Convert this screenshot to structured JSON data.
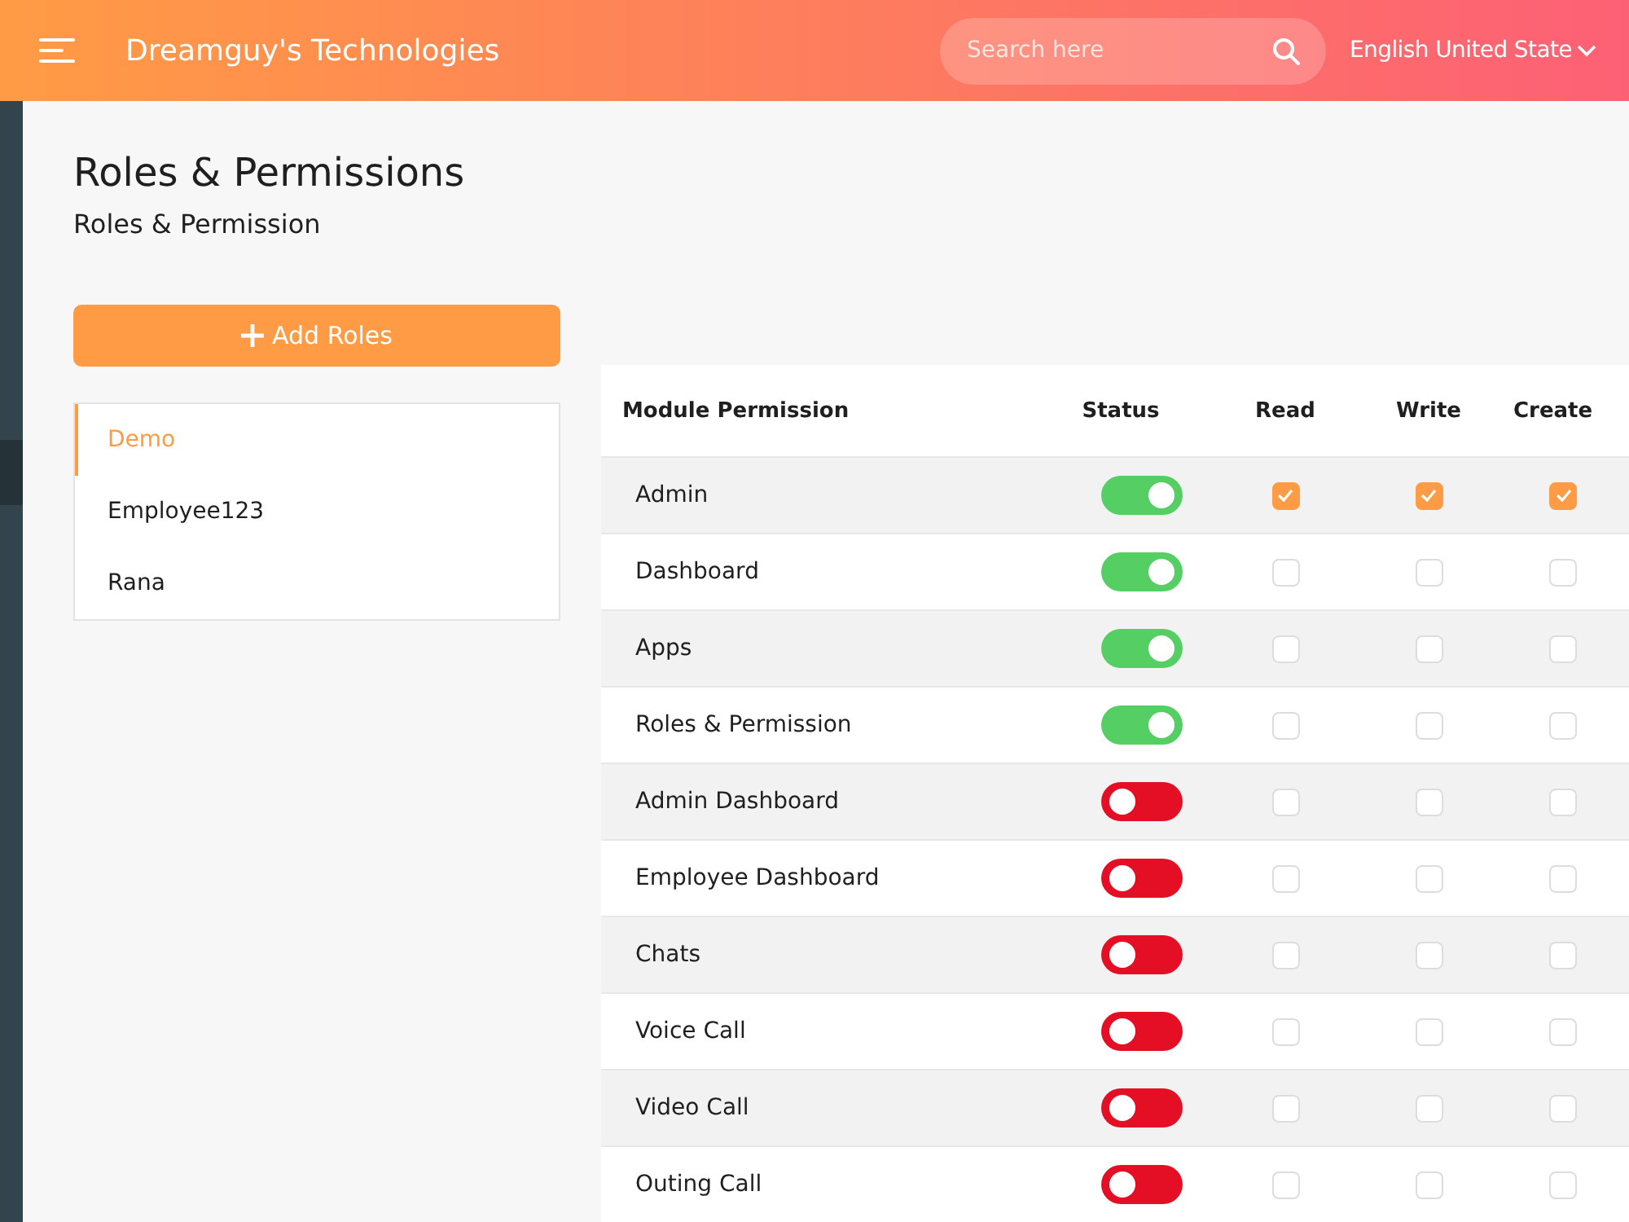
{
  "header": {
    "brand": "Dreamguy's Technologies",
    "search": {
      "placeholder": "Search here"
    },
    "language": "English United State"
  },
  "page": {
    "title": "Roles & Permissions",
    "subtitle": "Roles & Permission"
  },
  "add_button": "Add Roles",
  "roles": [
    {
      "name": "Demo",
      "selected": true
    },
    {
      "name": "Employee123",
      "selected": false
    },
    {
      "name": "Rana",
      "selected": false
    }
  ],
  "table": {
    "columns": [
      "Module Permission",
      "Status",
      "Read",
      "Write",
      "Create"
    ],
    "rows": [
      {
        "module": "Admin",
        "on": true,
        "read": true,
        "write": true,
        "create": true
      },
      {
        "module": "Dashboard",
        "on": true,
        "read": false,
        "write": false,
        "create": false
      },
      {
        "module": "Apps",
        "on": true,
        "read": false,
        "write": false,
        "create": false
      },
      {
        "module": "Roles & Permission",
        "on": true,
        "read": false,
        "write": false,
        "create": false
      },
      {
        "module": "Admin Dashboard",
        "on": false,
        "read": false,
        "write": false,
        "create": false
      },
      {
        "module": "Employee Dashboard",
        "on": false,
        "read": false,
        "write": false,
        "create": false
      },
      {
        "module": "Chats",
        "on": false,
        "read": false,
        "write": false,
        "create": false
      },
      {
        "module": "Voice Call",
        "on": false,
        "read": false,
        "write": false,
        "create": false
      },
      {
        "module": "Video Call",
        "on": false,
        "read": false,
        "write": false,
        "create": false
      },
      {
        "module": "Outing Call",
        "on": false,
        "read": false,
        "write": false,
        "create": false
      }
    ]
  }
}
